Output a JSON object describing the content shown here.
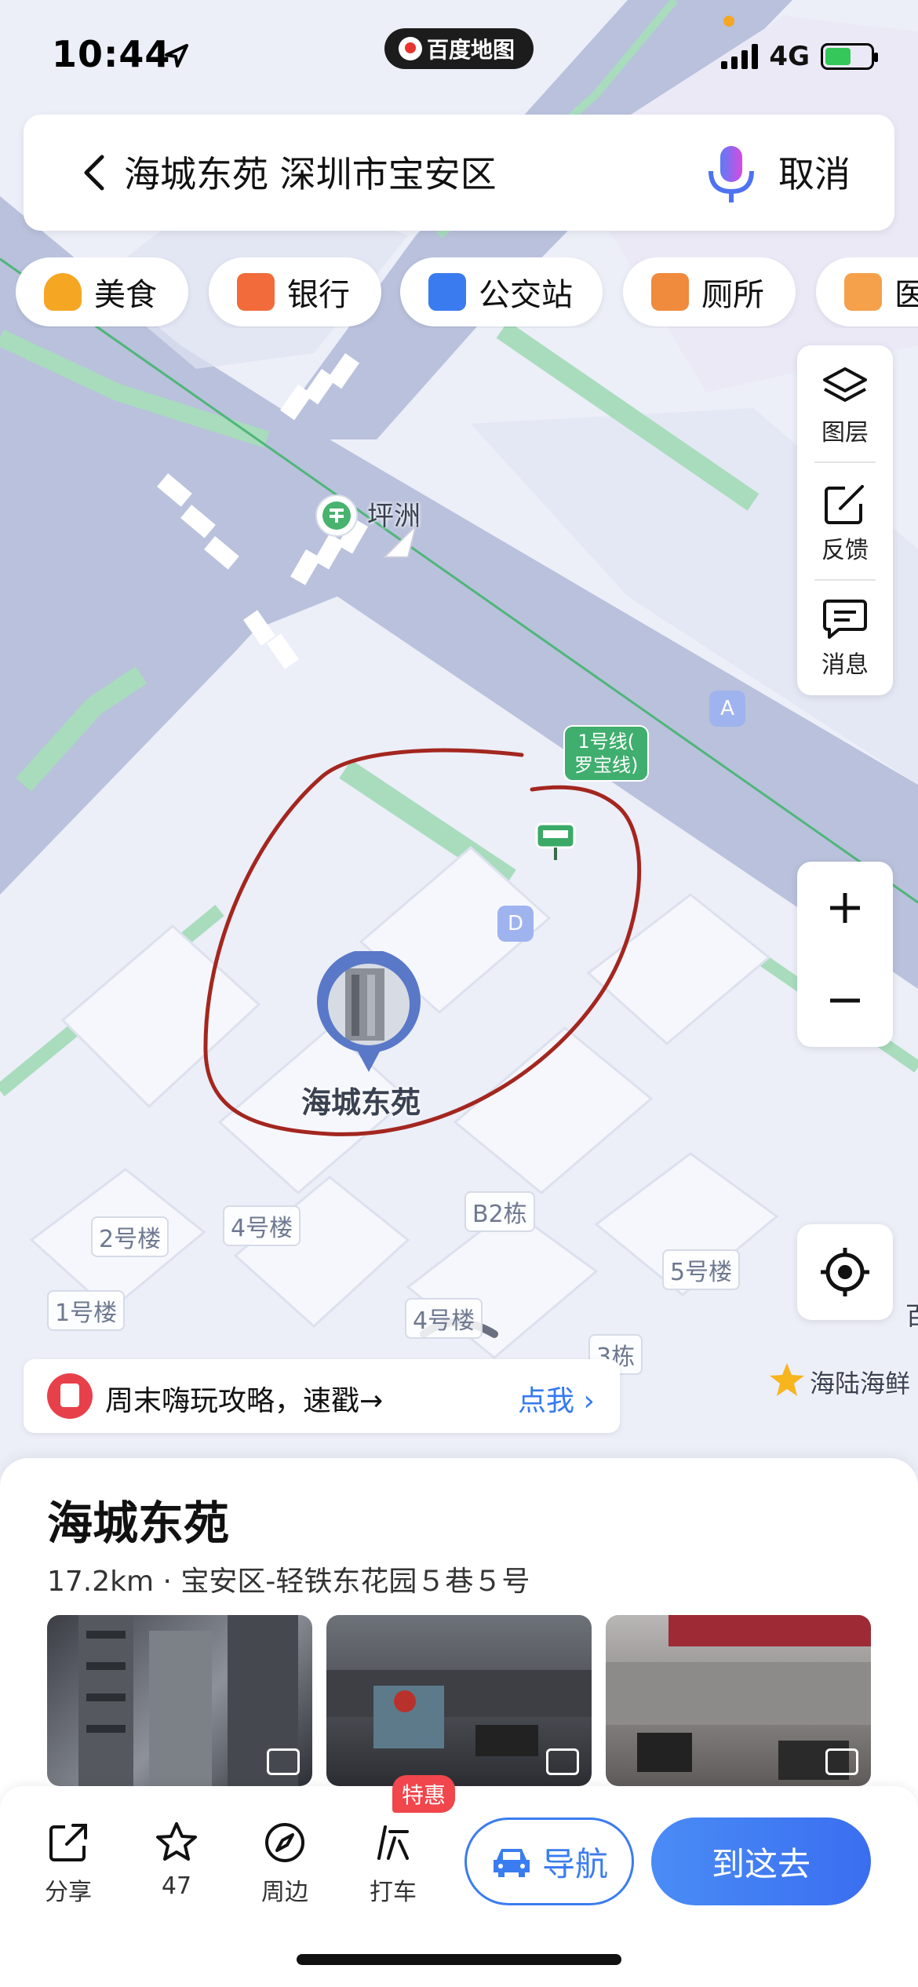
{
  "status": {
    "time": "10:44",
    "app_pill": "百度地图",
    "network": "4G"
  },
  "search": {
    "query": "海城东苑 深圳市宝安区",
    "cancel_label": "取消"
  },
  "categories": [
    {
      "label": "美食",
      "icon": "food-icon",
      "color": "#f5a623"
    },
    {
      "label": "银行",
      "icon": "bank-card-icon",
      "color": "#f26b3a"
    },
    {
      "label": "公交站",
      "icon": "bus-stop-icon",
      "color": "#3a7bf0"
    },
    {
      "label": "厕所",
      "icon": "toilet-icon",
      "color": "#f08a3c"
    },
    {
      "label": "医",
      "icon": "hospital-icon",
      "color": "#f5a04a"
    }
  ],
  "tools": {
    "layers": "图层",
    "feedback": "反馈",
    "messages": "消息"
  },
  "map": {
    "station_name": "坪洲",
    "line_badge": [
      "1号线(",
      "罗宝线)"
    ],
    "exit_a": "A",
    "exit_d": "D",
    "place_marker_label": "海城东苑",
    "buildings": [
      "2号楼",
      "4号楼",
      "B2栋",
      "5号楼",
      "1号楼",
      "4号楼",
      "3栋"
    ],
    "poi_right": "海陆海鲜",
    "edge_char": "百"
  },
  "promo": {
    "text": "周末嗨玩攻略，速戳→",
    "link": "点我"
  },
  "place": {
    "title": "海城东苑",
    "subtitle": "17.2km · 宝安区-轻铁东花园５巷５号"
  },
  "actions": {
    "share": "分享",
    "favorite_count": "47",
    "nearby": "周边",
    "taxi": "打车",
    "deal_badge": "特惠",
    "navigate": "导航",
    "go_here": "到这去"
  }
}
